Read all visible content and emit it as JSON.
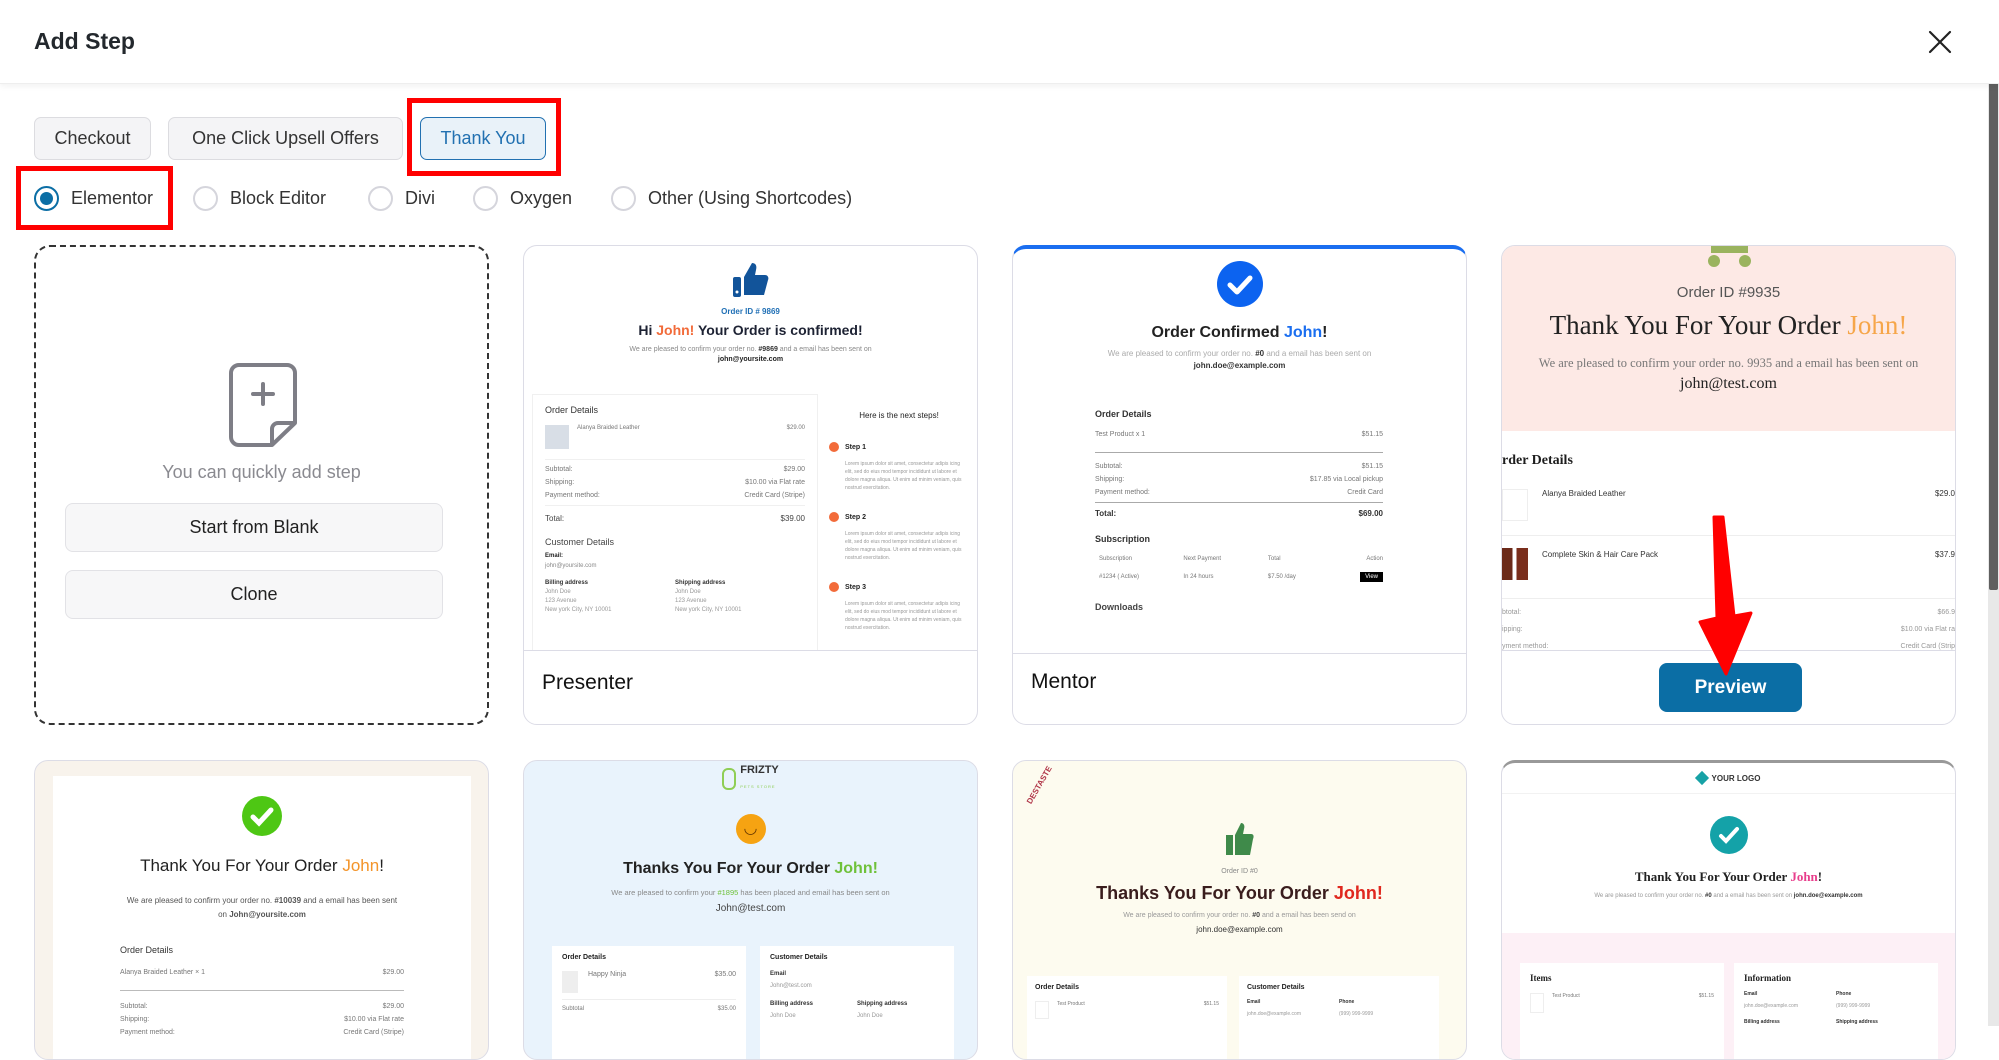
{
  "header": {
    "title": "Add Step",
    "close_icon": "close-icon"
  },
  "tabs": {
    "items": [
      {
        "label": "Checkout"
      },
      {
        "label": "One Click Upsell Offers"
      },
      {
        "label": "Thank You"
      }
    ],
    "active": "Thank You"
  },
  "builders": {
    "items": [
      {
        "label": "Elementor"
      },
      {
        "label": "Block Editor"
      },
      {
        "label": "Divi"
      },
      {
        "label": "Oxygen"
      },
      {
        "label": "Other (Using Shortcodes)"
      }
    ],
    "selected": "Elementor"
  },
  "blank_card": {
    "icon": "file-plus-icon",
    "text": "You can quickly add step",
    "start_blank": "Start from Blank",
    "clone": "Clone"
  },
  "preview_button": "Preview",
  "colors": {
    "accent": "#0b6ea5",
    "annotation": "#ff0000"
  },
  "templates": [
    {
      "name": "Presenter",
      "preview": {
        "order_id": "Order ID # 9869",
        "headline_a": "Hi ",
        "headline_name": "John!",
        "headline_b": " Your Order is confirmed!",
        "sub": "We are pleased to confirm your order no. ",
        "sub_num": "#9869",
        "sub_b": " and a email has been sent on",
        "email": "john@yoursite.com",
        "order_details": "Order Details",
        "product": "Alanya Braided Leather",
        "product_price": "$29.00",
        "subtotal_label": "Subtotal:",
        "subtotal": "$29.00",
        "shipping_label": "Shipping:",
        "shipping": "$10.00 via Flat rate",
        "payment_label": "Payment method:",
        "payment": "Credit Card (Stripe)",
        "total_label": "Total:",
        "total": "$39.00",
        "customer_details": "Customer Details",
        "email_label": "Email:",
        "customer_email": "john@yoursite.com",
        "billing": "Billing address",
        "shipping_addr": "Shipping address",
        "addr1": "John Doe",
        "addr2": "123 Avenue",
        "addr3": "New york City, NY 10001",
        "next_steps": "Here is the next steps!",
        "step1": "Step 1",
        "step2": "Step 2",
        "step3": "Step 3",
        "lorem": "Lorem ipsum dolor sit amet, consectetur adipis icing elit, sed do eius mod tempor incididunt ut labore et dolore magna aliqua. Ut enim ad minim veniam, quis nostrud exercitation."
      }
    },
    {
      "name": "Mentor",
      "preview": {
        "headline_a": "Order Confirmed ",
        "headline_name": "John",
        "headline_b": "!",
        "sub": "We are pleased to confirm your order no. ",
        "sub_num": "#0",
        "sub_b": " and a email has been sent on ",
        "email": "john.doe@example.com",
        "order_details": "Order Details",
        "product": "Test Product  x 1",
        "product_price": "$51.15",
        "subtotal_label": "Subtotal:",
        "subtotal": "$51.15",
        "shipping_label": "Shipping:",
        "shipping": "$17.85 via Local pickup",
        "payment_label": "Payment method:",
        "payment": "Credit Card",
        "total_label": "Total:",
        "total": "$69.00",
        "subscription": "Subscription",
        "cols": [
          "Subscription",
          "Next Payment",
          "Total",
          "Action"
        ],
        "row": [
          "#1234 ( Active)",
          "In 24 hours",
          "$7.50 /day"
        ],
        "view": "View",
        "downloads": "Downloads"
      }
    },
    {
      "name": "",
      "preview": {
        "order_id": "Order ID #9935",
        "headline_a": "Thank You For Your Order ",
        "headline_name": "John!",
        "sub": "We are pleased to confirm your order no. 9935 and a email has been sent on",
        "email": "john@test.com",
        "order_details": "rder Details",
        "product1": "Alanya Braided Leather",
        "price1": "$29.0",
        "product2": "Complete Skin & Hair Care Pack",
        "price2": "$37.9",
        "subtotal_label": "btotal:",
        "subtotal": "$66.9",
        "shipping_label": "ipping:",
        "shipping": "$10.00 via Flat ra",
        "payment_label": "yment method:",
        "payment": "Credit Card (Strip"
      }
    },
    {
      "name": "",
      "preview": {
        "headline_a": "Thank You For Your Order ",
        "headline_name": "John",
        "headline_b": "!",
        "sub": "We are pleased to confirm your order no. ",
        "sub_num": "#10039",
        "sub_b": " and a email has been sent on ",
        "email": "John@yoursite.com",
        "order_details": "Order Details",
        "product": "Alanya Braided Leather  × 1",
        "product_price": "$29.00",
        "subtotal_label": "Subtotal:",
        "subtotal": "$29.00",
        "shipping_label": "Shipping:",
        "shipping": "$10.00 via Flat rate",
        "payment_label": "Payment method:",
        "payment": "Credit Card (Stripe)"
      }
    },
    {
      "name": "",
      "preview": {
        "logo": "FRIZTY",
        "logo_sub": "PETS STORE",
        "headline_a": "Thanks You For Your Order ",
        "headline_name": "John!",
        "sub": "We are pleased to confirm your ",
        "sub_num": "#1895",
        "sub_b": " has been placed and email has been sent on",
        "email": "John@test.com",
        "order_details": "Order Details",
        "product": "Happy Ninja",
        "product_price": "$35.00",
        "subtotal_label": "Subtotal",
        "subtotal": "$35.00",
        "customer_details": "Customer Details",
        "email_label": "Email",
        "customer_email": "John@test.com",
        "billing": "Billing address",
        "shipping_addr": "Shipping address",
        "addr1": "John Doe"
      }
    },
    {
      "name": "",
      "preview": {
        "logo": "DESTASTE",
        "order_id": "Order ID #0",
        "headline_a": "Thanks You For Your Order ",
        "headline_name": "John!",
        "sub": "We are pleased to confirm your order no. ",
        "sub_num": "#0",
        "sub_b": " and a email has been send on",
        "email": "john.doe@example.com",
        "order_details": "Order Details",
        "product": "Test Product",
        "product_price": "$51.15",
        "customer_details": "Customer Details",
        "email_label": "Email",
        "phone_label": "Phone",
        "customer_email": "john.doe@example.com",
        "phone": "(999) 999-9999"
      }
    },
    {
      "name": "",
      "preview": {
        "logo": "YOUR LOGO",
        "headline_a": "Thank You For Your Order ",
        "headline_name": "John",
        "headline_b": "!",
        "sub": "We are pleased to confirm your order no. ",
        "sub_num": "#0",
        "sub_b": " and a email has been sent on ",
        "email": "john.doe@example.com",
        "items": "Items",
        "product": "Test Product",
        "product_price": "$51.15",
        "information": "Information",
        "email_label": "Email",
        "phone_label": "Phone",
        "customer_email": "john.doe@example.com",
        "phone": "(999) 999-9999",
        "billing": "Billing address",
        "shipping_addr": "Shipping address"
      }
    }
  ]
}
